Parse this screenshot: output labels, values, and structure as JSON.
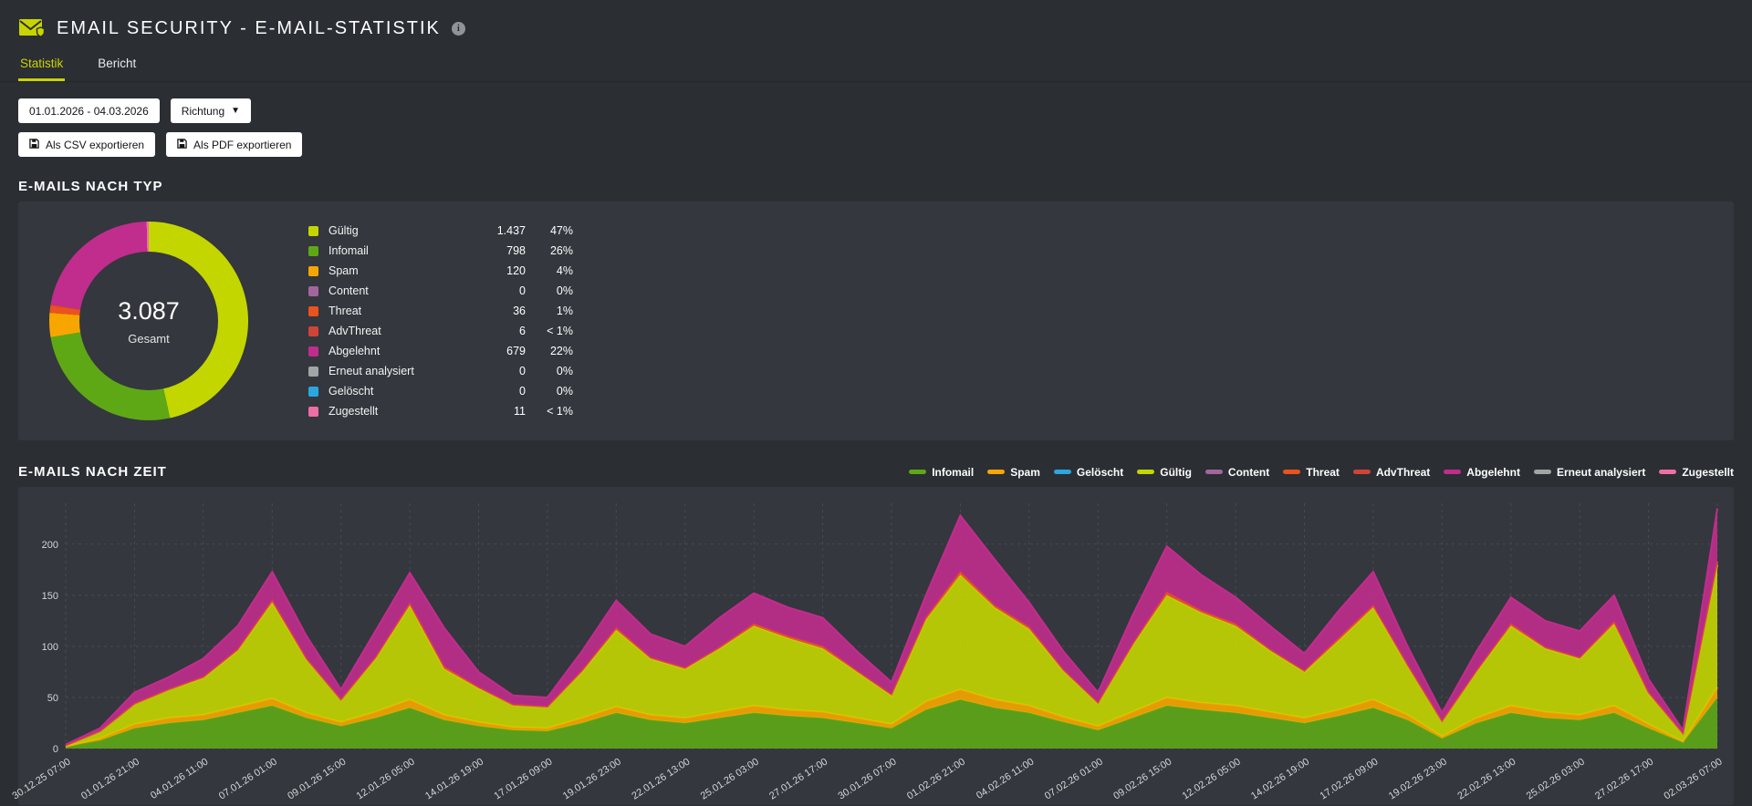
{
  "colors": {
    "accent": "#c8d400",
    "page_bg": "#2b2e33",
    "panel_bg": "#34373d"
  },
  "header": {
    "title": "EMAIL SECURITY - E-MAIL-STATISTIK"
  },
  "tabs": [
    {
      "label": "Statistik",
      "active": true
    },
    {
      "label": "Bericht",
      "active": false
    }
  ],
  "toolbar": {
    "date_range": "01.01.2026 - 04.03.2026",
    "direction_label": "Richtung",
    "export_csv": "Als CSV exportieren",
    "export_pdf": "Als PDF exportieren"
  },
  "sections": {
    "by_type_title": "E-MAILS NACH TYP",
    "by_time_title": "E-MAILS NACH ZEIT"
  },
  "donut": {
    "total_label": "3.087",
    "total_caption": "Gesamt",
    "rows": [
      {
        "label": "Gültig",
        "value": "1.437",
        "pct": "47%",
        "color": "#c3d600",
        "share": 46.55
      },
      {
        "label": "Infomail",
        "value": "798",
        "pct": "26%",
        "color": "#5ea816",
        "share": 25.85
      },
      {
        "label": "Spam",
        "value": "120",
        "pct": "4%",
        "color": "#f7a600",
        "share": 3.89
      },
      {
        "label": "Content",
        "value": "0",
        "pct": "0%",
        "color": "#a3669c",
        "share": 0
      },
      {
        "label": "Threat",
        "value": "36",
        "pct": "1%",
        "color": "#e9531d",
        "share": 1.17
      },
      {
        "label": "AdvThreat",
        "value": "6",
        "pct": "< 1%",
        "color": "#cf4436",
        "share": 0.19
      },
      {
        "label": "Abgelehnt",
        "value": "679",
        "pct": "22%",
        "color": "#c02d8c",
        "share": 22.0
      },
      {
        "label": "Erneut analysiert",
        "value": "0",
        "pct": "0%",
        "color": "#a2a4a6",
        "share": 0
      },
      {
        "label": "Gelöscht",
        "value": "0",
        "pct": "0%",
        "color": "#2aa7df",
        "share": 0
      },
      {
        "label": "Zugestellt",
        "value": "11",
        "pct": "< 1%",
        "color": "#ee6ea6",
        "share": 0.36
      }
    ]
  },
  "chart_data": {
    "type": "area",
    "stacked": true,
    "title": "E-Mails nach Zeit",
    "ylim": [
      0,
      240
    ],
    "yticks": [
      0,
      50,
      100,
      150,
      200
    ],
    "grid": true,
    "legend_position": "top-right",
    "categories": [
      "30.12.25 07:00",
      "01.01.26 21:00",
      "04.01.26 11:00",
      "07.01.26 01:00",
      "09.01.26 15:00",
      "12.01.26 05:00",
      "14.01.26 19:00",
      "17.01.26 09:00",
      "19.01.26 23:00",
      "22.01.26 13:00",
      "25.01.26 03:00",
      "27.01.26 17:00",
      "30.01.26 07:00",
      "01.02.26 21:00",
      "04.02.26 11:00",
      "07.02.26 01:00",
      "09.02.26 15:00",
      "12.02.26 05:00",
      "14.02.26 19:00",
      "17.02.26 09:00",
      "19.02.26 23:00",
      "22.02.26 13:00",
      "25.02.26 03:00",
      "27.02.26 17:00",
      "02.03.26 07:00"
    ],
    "points_per_label": 2,
    "series": [
      {
        "name": "Infomail",
        "color": "#5ea816",
        "values": [
          2,
          8,
          20,
          25,
          28,
          35,
          42,
          30,
          22,
          30,
          40,
          28,
          22,
          18,
          17,
          25,
          35,
          28,
          25,
          30,
          35,
          32,
          30,
          25,
          20,
          38,
          48,
          40,
          35,
          26,
          18,
          30,
          42,
          38,
          35,
          30,
          25,
          32,
          40,
          28,
          10,
          25,
          35,
          30,
          28,
          35,
          20,
          6,
          50
        ]
      },
      {
        "name": "Spam",
        "color": "#f7a600",
        "values": [
          0,
          2,
          4,
          5,
          5,
          6,
          7,
          5,
          4,
          6,
          8,
          5,
          4,
          3,
          3,
          5,
          6,
          5,
          5,
          6,
          7,
          6,
          6,
          5,
          4,
          8,
          10,
          8,
          7,
          5,
          4,
          6,
          8,
          7,
          7,
          6,
          5,
          6,
          8,
          5,
          2,
          5,
          7,
          6,
          5,
          7,
          4,
          1,
          10
        ]
      },
      {
        "name": "Gelöscht",
        "color": "#2aa7df",
        "values": [
          0
        ]
      },
      {
        "name": "Gültig",
        "color": "#c3d600",
        "values": [
          1,
          7,
          20,
          28,
          36,
          55,
          94,
          52,
          22,
          52,
          92,
          45,
          33,
          22,
          21,
          45,
          75,
          55,
          48,
          62,
          78,
          70,
          62,
          45,
          28,
          80,
          112,
          90,
          75,
          45,
          22,
          65,
          100,
          88,
          78,
          60,
          45,
          68,
          90,
          48,
          15,
          45,
          78,
          62,
          55,
          80,
          30,
          8,
          120
        ]
      },
      {
        "name": "Content",
        "color": "#a3669c",
        "values": [
          0
        ]
      },
      {
        "name": "Threat",
        "color": "#e9531d",
        "values": [
          0,
          0,
          0,
          0,
          1,
          1,
          2,
          1,
          0,
          1,
          2,
          2,
          1,
          0,
          0,
          1,
          2,
          1,
          1,
          1,
          2,
          2,
          2,
          1,
          1,
          2,
          3,
          2,
          2,
          1,
          1,
          1,
          3,
          2,
          2,
          1,
          1,
          2,
          2,
          1,
          0,
          1,
          2,
          1,
          1,
          2,
          1,
          0,
          3
        ]
      },
      {
        "name": "AdvThreat",
        "color": "#cf4436",
        "values": [
          0
        ]
      },
      {
        "name": "Abgelehnt",
        "color": "#c02d8c",
        "values": [
          1,
          3,
          11,
          12,
          18,
          23,
          28,
          22,
          10,
          26,
          30,
          38,
          15,
          9,
          9,
          19,
          27,
          23,
          21,
          29,
          30,
          28,
          28,
          19,
          12,
          22,
          55,
          45,
          24,
          18,
          10,
          28,
          45,
          35,
          26,
          23,
          17,
          27,
          33,
          18,
          8,
          19,
          26,
          26,
          26,
          26,
          13,
          3,
          52
        ]
      },
      {
        "name": "Erneut analysiert",
        "color": "#a2a4a6",
        "values": [
          0
        ]
      },
      {
        "name": "Zugestellt",
        "color": "#ee6ea6",
        "values": [
          0
        ]
      }
    ]
  }
}
